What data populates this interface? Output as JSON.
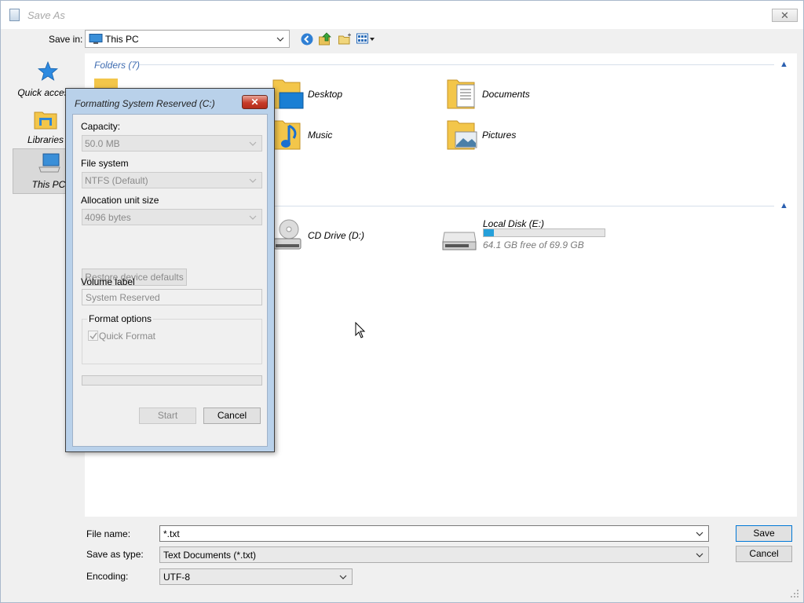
{
  "window": {
    "title": "Save As",
    "close_glyph": "✕"
  },
  "toolbar": {
    "savein_label": "Save in:",
    "savein_value": "This PC",
    "icons": [
      "back-icon",
      "up-folder-icon",
      "new-folder-icon",
      "view-menu-icon"
    ]
  },
  "sidebar": {
    "items": [
      {
        "label": "Quick access",
        "icon": "star-icon"
      },
      {
        "label": "Libraries",
        "icon": "libraries-icon"
      },
      {
        "label": "This PC",
        "icon": "computer-icon",
        "selected": true
      }
    ]
  },
  "content": {
    "folders_header": "Folders (7)",
    "folders": [
      {
        "name": "Desktop",
        "icon": "desktop-folder-icon"
      },
      {
        "name": "Documents",
        "icon": "documents-folder-icon"
      },
      {
        "name": "Music",
        "icon": "music-folder-icon"
      },
      {
        "name": "Pictures",
        "icon": "pictures-folder-icon"
      }
    ],
    "devices": [
      {
        "name": "CD Drive (D:)",
        "icon": "cd-drive-icon"
      },
      {
        "name": "Local Disk (E:)",
        "icon": "hard-disk-icon",
        "free_text": "64.1 GB free of 69.9 GB",
        "used_fraction": 0.083
      }
    ]
  },
  "bottom": {
    "filename_label": "File name:",
    "filename_value": "*.txt",
    "type_label": "Save as type:",
    "type_value": "Text Documents (*.txt)",
    "encoding_label": "Encoding:",
    "encoding_value": "UTF-8",
    "save_label": "Save",
    "cancel_label": "Cancel"
  },
  "format_dialog": {
    "title": "Formatting System Reserved (C:)",
    "close_glyph": "✕",
    "capacity_label": "Capacity:",
    "capacity_value": "50.0 MB",
    "filesystem_label": "File system",
    "filesystem_value": "NTFS (Default)",
    "allocation_label": "Allocation unit size",
    "allocation_value": "4096 bytes",
    "restore_label": "Restore device defaults",
    "volume_label": "Volume label",
    "volume_value": "System Reserved",
    "options_legend": "Format options",
    "quick_format_label": "Quick Format",
    "quick_format_checked": true,
    "start_label": "Start",
    "cancel_label": "Cancel"
  },
  "colors": {
    "accent": "#3d6bb0",
    "disk_bar": "#26a0da",
    "close_red": "#c73c2a"
  }
}
